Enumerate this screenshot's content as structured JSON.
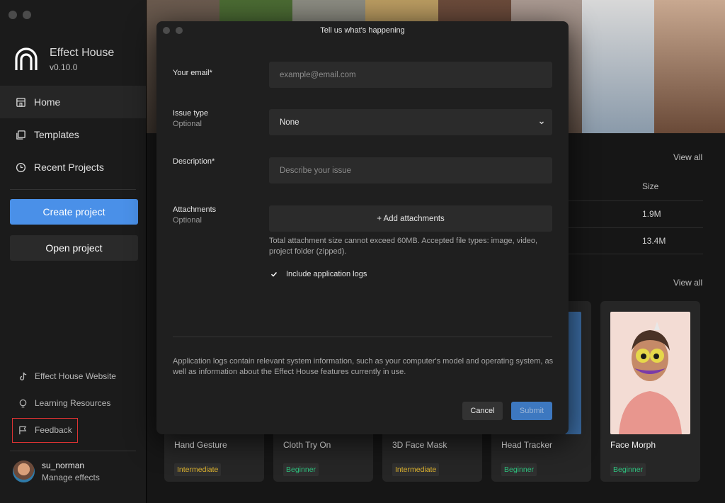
{
  "app": {
    "name": "Effect House",
    "version": "v0.10.0"
  },
  "sidebar": {
    "items": [
      {
        "label": "Home",
        "icon": "home-icon"
      },
      {
        "label": "Templates",
        "icon": "templates-icon"
      },
      {
        "label": "Recent Projects",
        "icon": "clock-icon"
      }
    ],
    "create_label": "Create project",
    "open_label": "Open project",
    "links": [
      {
        "label": "Effect House Website",
        "icon": "tiktok-icon"
      },
      {
        "label": "Learning Resources",
        "icon": "lightbulb-icon"
      },
      {
        "label": "Feedback",
        "icon": "flag-icon"
      }
    ],
    "user": {
      "name": "su_norman",
      "sub": "Manage effects"
    }
  },
  "main": {
    "view_all_1": "View all",
    "view_all_2": "View all",
    "size_header": "Size",
    "sizes": [
      "1.9M",
      "13.4M"
    ],
    "cards": [
      {
        "title": "Hand Gesture",
        "level": "Intermediate"
      },
      {
        "title": "Cloth Try On",
        "level": "Beginner"
      },
      {
        "title": "3D Face Mask",
        "level": "Intermediate"
      },
      {
        "title": "Head Tracker",
        "level": "Beginner"
      },
      {
        "title": "Face Morph",
        "level": "Beginner"
      }
    ]
  },
  "dialog": {
    "title": "Tell us what's happening",
    "email_label": "Your email*",
    "email_placeholder": "example@email.com",
    "issue_label": "Issue type",
    "issue_optional": "Optional",
    "issue_value": "None",
    "desc_label": "Description*",
    "desc_placeholder": "Describe your issue",
    "attach_label": "Attachments",
    "attach_optional": "Optional",
    "attach_button": "+ Add attachments",
    "attach_hint": "Total attachment size cannot exceed 60MB. Accepted file types: image, video, project folder (zipped).",
    "logs_label": "Include application logs",
    "logs_checked": true,
    "note": "Application logs contain relevant system information, such as your computer's model and operating system, as well as information about the Effect House features currently in use.",
    "cancel_label": "Cancel",
    "submit_label": "Submit"
  },
  "colors": {
    "accent": "#4a90e8",
    "intermediate": "#e0b52e",
    "beginner": "#2ec27e",
    "highlight": "#dd3333"
  }
}
